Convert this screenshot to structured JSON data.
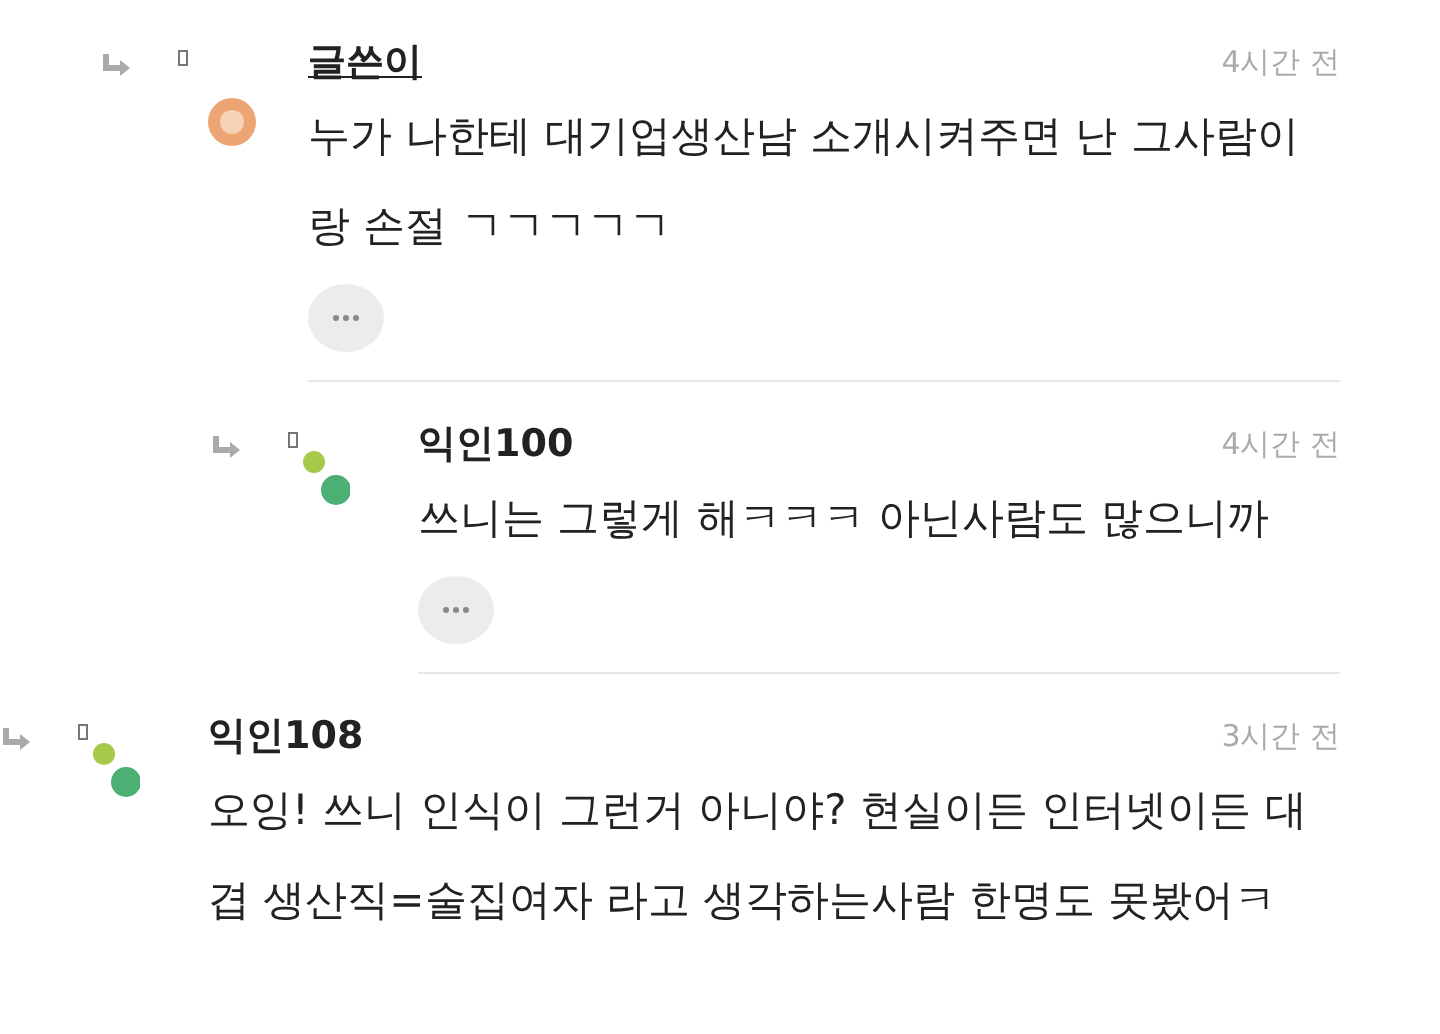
{
  "comments": [
    {
      "author": "글쓴이",
      "kind": "writer",
      "time": "4시간 전",
      "text": "누가 나한테 대기업생산남 소개시켜주면 난 그사람이랑 손절 ㄱㄱㄱㄱㄱ",
      "children": [
        {
          "author": "익인100",
          "kind": "anonymous",
          "time": "4시간 전",
          "text": "쓰니는 그렇게 해ㅋㅋㅋ 아닌사람도 많으니까"
        }
      ]
    },
    {
      "author": "익인108",
      "kind": "anonymous",
      "time": "3시간 전",
      "text": "오잉! 쓰니 인식이 그런거 아니야? 현실이든 인터넷이든 대겹 생산직=술집여자 라고 생각하는사람 한명도 못봤어ㅋ"
    }
  ]
}
